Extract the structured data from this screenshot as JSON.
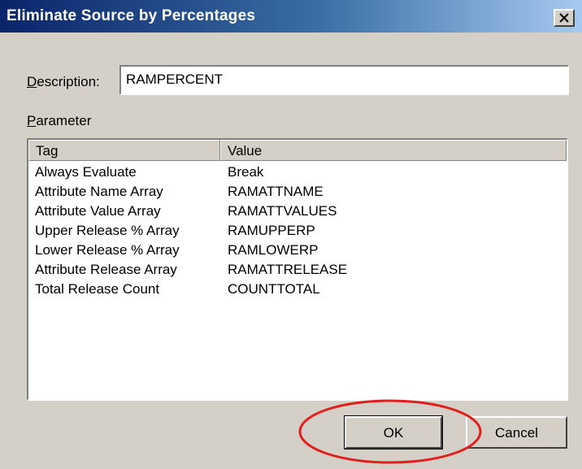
{
  "window": {
    "title": "Eliminate Source by Percentages",
    "close_icon": "close-icon"
  },
  "description": {
    "label": "Description:",
    "value": "RAMPERCENT"
  },
  "parameter": {
    "label": "Parameter",
    "columns": {
      "tag": "Tag",
      "value": "Value"
    },
    "rows": [
      {
        "tag": "Always Evaluate",
        "value": "Break"
      },
      {
        "tag": "Attribute Name Array",
        "value": "RAMATTNAME"
      },
      {
        "tag": "Attribute Value Array",
        "value": "RAMATTVALUES"
      },
      {
        "tag": "Upper Release % Array",
        "value": "RAMUPPERP"
      },
      {
        "tag": "Lower Release % Array",
        "value": "RAMLOWERP"
      },
      {
        "tag": "Attribute Release Array",
        "value": "RAMATTRELEASE"
      },
      {
        "tag": "Total Release Count",
        "value": "COUNTTOTAL"
      }
    ]
  },
  "buttons": {
    "ok": "OK",
    "cancel": "Cancel"
  },
  "colors": {
    "title_gradient_start": "#0a246a",
    "title_gradient_end": "#a6caf0",
    "dialog_bg": "#d4d0c8",
    "highlight_ring": "#e0201c"
  }
}
